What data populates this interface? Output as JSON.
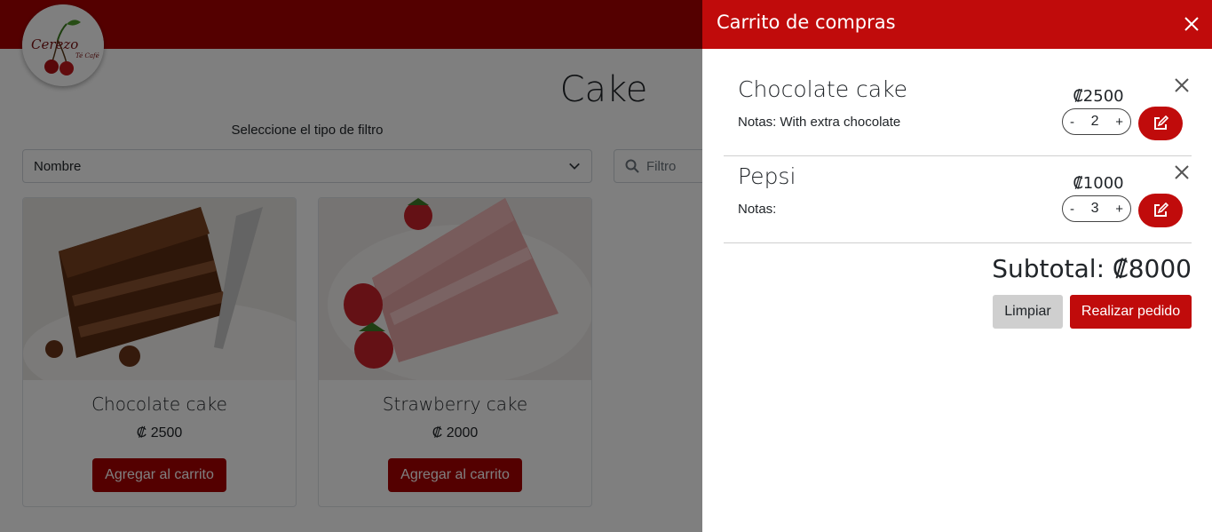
{
  "brand": {
    "logo_text": "Cerezo",
    "logo_sub": "Té Café"
  },
  "page": {
    "title": "Cake",
    "filter_label": "Seleccione el tipo de filtro",
    "filter_select_value": "Nombre",
    "search_placeholder": "Filtro"
  },
  "products": [
    {
      "name": "Chocolate cake",
      "price": "₡ 2500",
      "button": "Agregar al carrito"
    },
    {
      "name": "Strawberry cake",
      "price": "₡ 2000",
      "button": "Agregar al carrito"
    }
  ],
  "cart": {
    "title": "Carrito de compras",
    "items": [
      {
        "name": "Chocolate cake",
        "notes_label": "Notas:",
        "notes": "With extra chocolate",
        "price": "₡2500",
        "qty": "2",
        "minus": "-",
        "plus": "+"
      },
      {
        "name": "Pepsi",
        "notes_label": "Notas:",
        "notes": "",
        "price": "₡1000",
        "qty": "3",
        "minus": "-",
        "plus": "+"
      }
    ],
    "subtotal": "Subtotal: ₡8000",
    "clear_label": "Limpiar",
    "order_label": "Realizar pedido"
  },
  "colors": {
    "brand_red": "#a90000",
    "cart_red": "#c00b0b",
    "clear_gray": "#cfcfcf"
  }
}
